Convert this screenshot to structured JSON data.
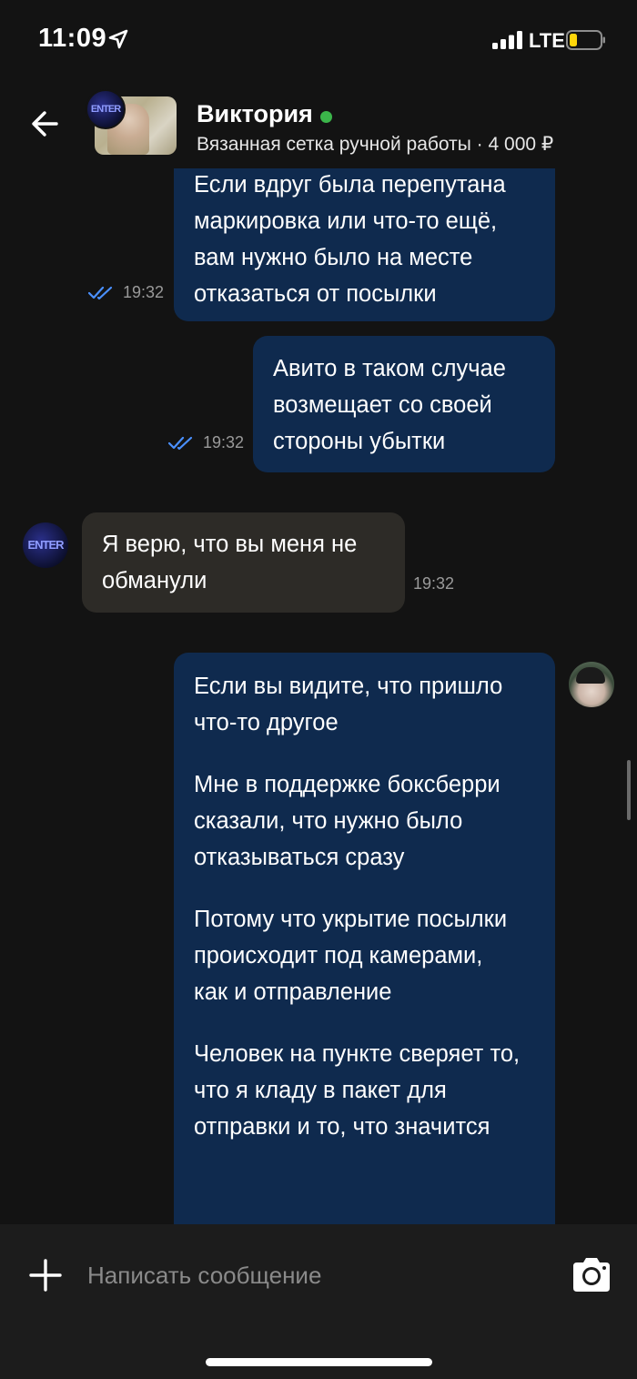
{
  "status_bar": {
    "time": "11:09",
    "network": "LTE",
    "icons": [
      "location-arrow-icon",
      "signal-bars-icon",
      "battery-low-icon"
    ]
  },
  "header": {
    "contact_name": "Виктория",
    "online_color": "#3bb54a",
    "listing_line": "Вязанная сетка ручной работы · 4 000 ₽"
  },
  "messages": [
    {
      "direction": "outgoing",
      "paragraphs": [
        "Если вдруг была перепутана маркировка или что-то ещё, вам нужно было на месте отказаться от посылки"
      ],
      "time": "19:32",
      "status": "read"
    },
    {
      "direction": "outgoing",
      "paragraphs": [
        "Авито в таком случае возмещает со своей стороны убытки"
      ],
      "time": "19:32",
      "status": "read"
    },
    {
      "direction": "incoming",
      "paragraphs": [
        "Я верю, что вы меня не обманули"
      ],
      "time": "19:32"
    },
    {
      "direction": "outgoing",
      "paragraphs": [
        "Если вы видите, что пришло что-то другое",
        "Мне в поддержке боксберри сказали, что нужно было отказываться сразу",
        "Потому что укрытие посылки происходит под камерами, как и отправление",
        "Человек на пункте сверяет то, что я кладу в пакет для отправки и то, что значится"
      ]
    }
  ],
  "avatar_text": "ENTER",
  "composer": {
    "placeholder": "Написать сообщение"
  },
  "colors": {
    "background": "#131313",
    "outgoing_bubble": "#0f2a4e",
    "incoming_bubble": "#2d2b27",
    "read_checks": "#4a90ff"
  }
}
